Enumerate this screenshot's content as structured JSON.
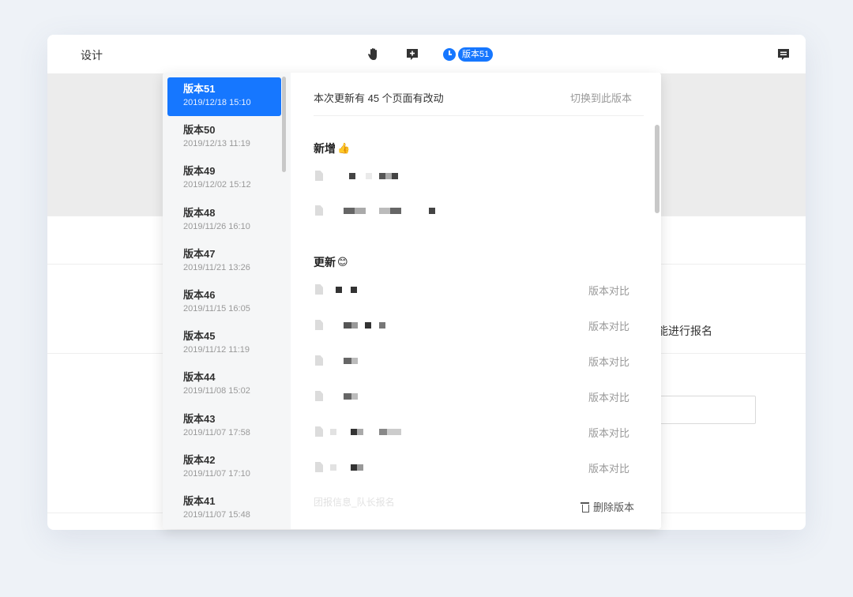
{
  "header": {
    "title": "设计",
    "icons": [
      "hand-icon",
      "add-comment-icon",
      "clock-icon",
      "chat-icon"
    ],
    "version_badge": "版本51"
  },
  "background": {
    "partial_text": "能进行报名"
  },
  "versions": [
    {
      "name": "版本51",
      "date": "2019/12/18 15:10",
      "active": true
    },
    {
      "name": "版本50",
      "date": "2019/12/13 11:19"
    },
    {
      "name": "版本49",
      "date": "2019/12/02 15:12"
    },
    {
      "name": "版本48",
      "date": "2019/11/26 16:10"
    },
    {
      "name": "版本47",
      "date": "2019/11/21 13:26"
    },
    {
      "name": "版本46",
      "date": "2019/11/15 16:05"
    },
    {
      "name": "版本45",
      "date": "2019/11/12 11:19"
    },
    {
      "name": "版本44",
      "date": "2019/11/08 15:02"
    },
    {
      "name": "版本43",
      "date": "2019/11/07 17:58"
    },
    {
      "name": "版本42",
      "date": "2019/11/07 17:10"
    },
    {
      "name": "版本41",
      "date": "2019/11/07 15:48"
    }
  ],
  "detail": {
    "summary": "本次更新有 45 个页面有改动",
    "switch_label": "切换到此版本",
    "new_section": {
      "title": "新增",
      "emoji": "👍"
    },
    "update_section": {
      "title": "更新",
      "emoji": "😊"
    },
    "compare_label": "版本对比",
    "faded_row": "团报信息_队长报名",
    "delete_label": "删除版本"
  },
  "colors": {
    "accent": "#1677ff",
    "list_bg": "#f5f6f7",
    "muted_text": "#999999"
  }
}
